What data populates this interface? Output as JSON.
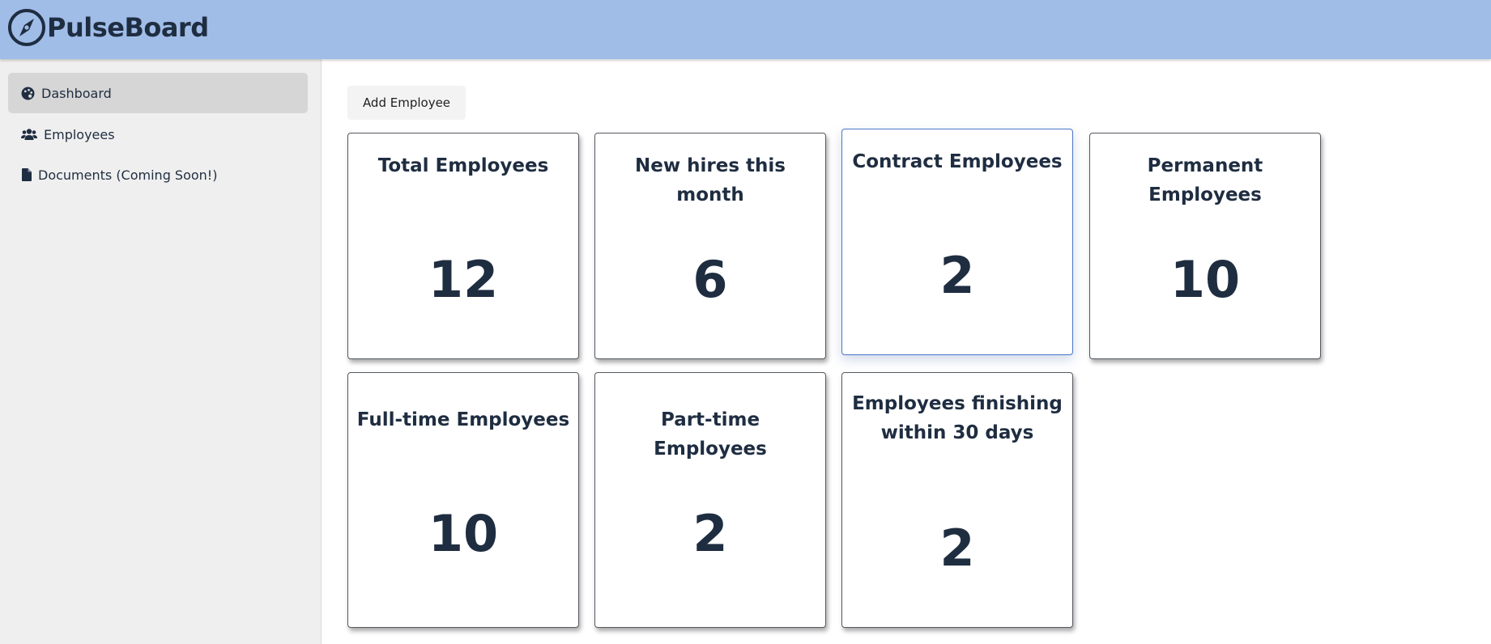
{
  "app": {
    "title": "PulseBoard"
  },
  "sidebar": {
    "items": [
      {
        "label": "Dashboard",
        "icon": "palette-icon",
        "active": true
      },
      {
        "label": "Employees",
        "icon": "users-icon",
        "active": false
      },
      {
        "label": "Documents (Coming Soon!)",
        "icon": "file-icon",
        "active": false
      }
    ]
  },
  "toolbar": {
    "add_employee_label": "Add Employee"
  },
  "cards": [
    {
      "title": "Total Employees",
      "value": "12"
    },
    {
      "title": "New hires this month",
      "value": "6"
    },
    {
      "title": "Contract Employees",
      "value": "2"
    },
    {
      "title": "Permanent Employees",
      "value": "10"
    },
    {
      "title": "Full-time Employees",
      "value": "10"
    },
    {
      "title": "Part-time Employees",
      "value": "2"
    },
    {
      "title": "Employees finishing within 30 days",
      "value": "2"
    }
  ],
  "colors": {
    "header": "#a0bde8",
    "sidebar": "#efefef",
    "active_item": "#d6d6d6",
    "text": "#1f2d41",
    "highlight_border": "#4a76c8"
  }
}
